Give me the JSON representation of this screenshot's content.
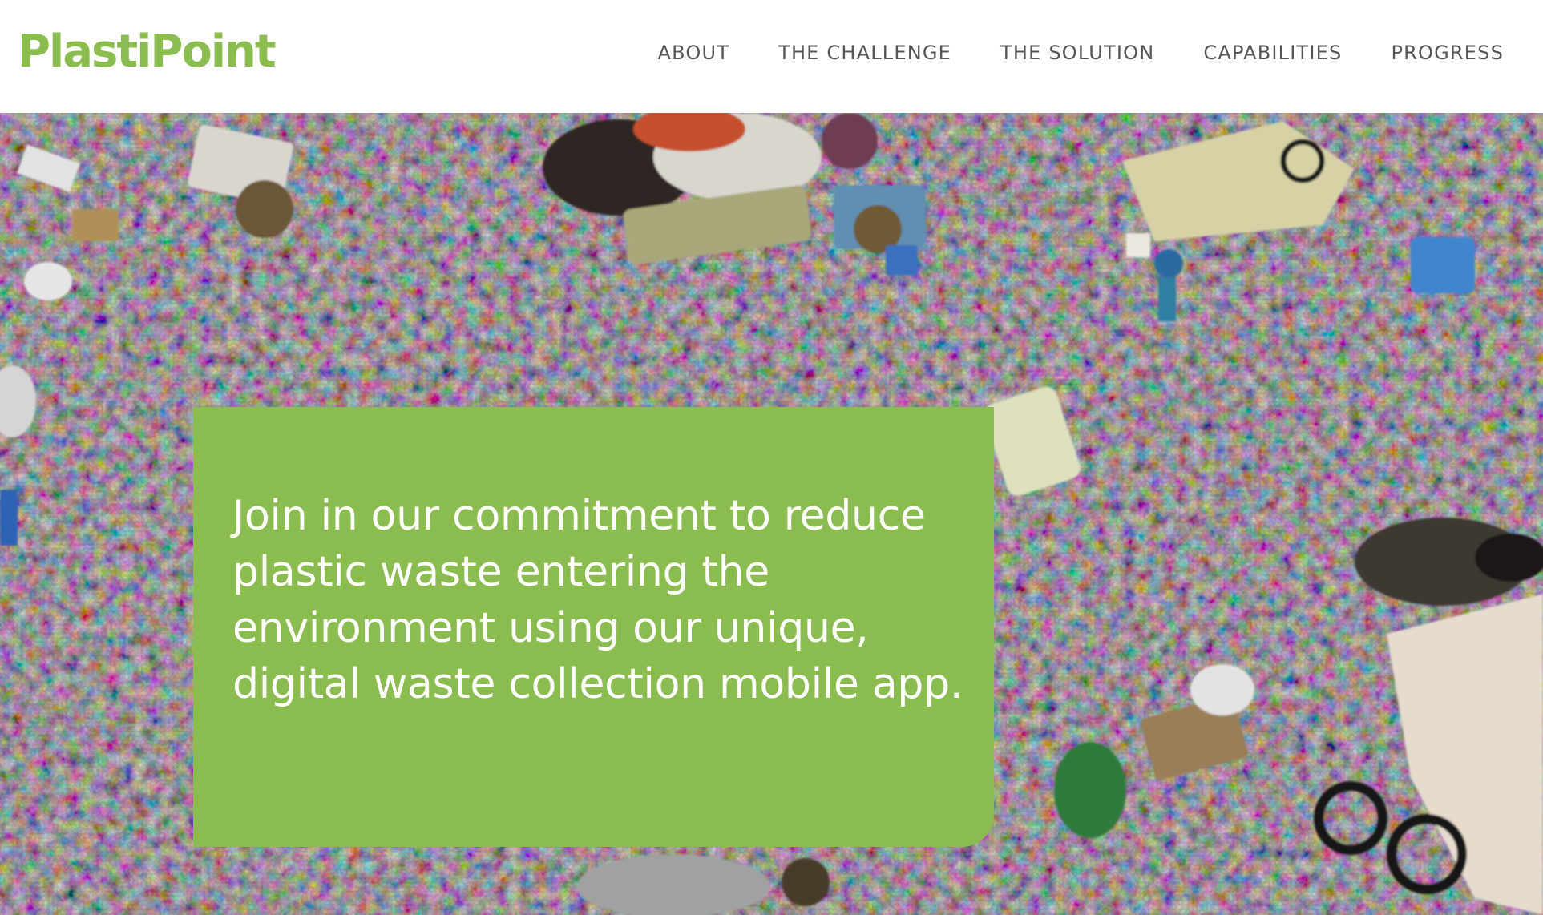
{
  "brand": {
    "logo_text": "PlastiPoint",
    "color": "#8bbc50"
  },
  "nav": {
    "items": [
      {
        "label": "ABOUT"
      },
      {
        "label": "THE CHALLENGE"
      },
      {
        "label": "THE SOLUTION"
      },
      {
        "label": "CAPABILITIES"
      },
      {
        "label": "PROGRESS"
      }
    ],
    "text_color": "#555555"
  },
  "hero": {
    "tagline": "Join in our commitment to reduce plastic waste entering the environment using our unique, digital waste collection mobile app.",
    "callout_color": "#8bbc50"
  }
}
